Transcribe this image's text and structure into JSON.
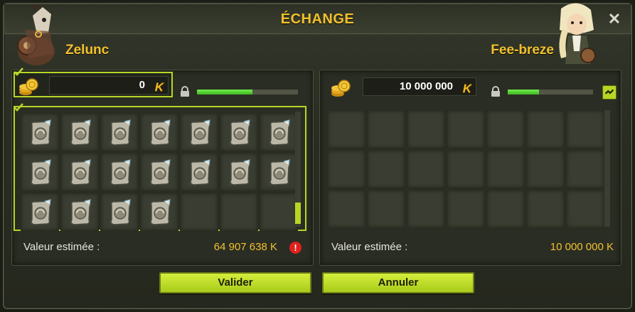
{
  "window": {
    "title": "ÉCHANGE",
    "close_glyph": "✕"
  },
  "left_player": {
    "name": "Zelunc",
    "kamas": "0",
    "kamas_symbol": "K",
    "progress_percent": 55,
    "inventory_items": [
      "scroll-icon",
      "scroll-icon",
      "scroll-icon",
      "scroll-icon",
      "scroll-icon",
      "scroll-icon",
      "scroll-icon",
      "scroll-icon",
      "scroll-icon",
      "scroll-icon",
      "scroll-icon",
      "scroll-icon",
      "scroll-icon",
      "scroll-icon",
      "scroll-icon",
      "scroll-icon",
      "scroll-icon",
      "scroll-icon"
    ],
    "slot_count": 21,
    "estimate_label": "Valeur estimée :",
    "estimate_value": "64 907 638 K",
    "warning_glyph": "!",
    "accent_color": "#b6d626"
  },
  "right_player": {
    "name": "Fee-breze",
    "kamas": "10 000 000",
    "kamas_symbol": "K",
    "progress_percent": 37,
    "slot_count": 21,
    "estimate_label": "Valeur estimée :",
    "estimate_value": "10 000 000 K"
  },
  "buttons": {
    "validate_label": "Valider",
    "cancel_label": "Annuler"
  },
  "colors": {
    "title": "#f2c12e",
    "accent": "#b6d626",
    "progress": "#4fd12e",
    "warning": "#e0201c"
  }
}
